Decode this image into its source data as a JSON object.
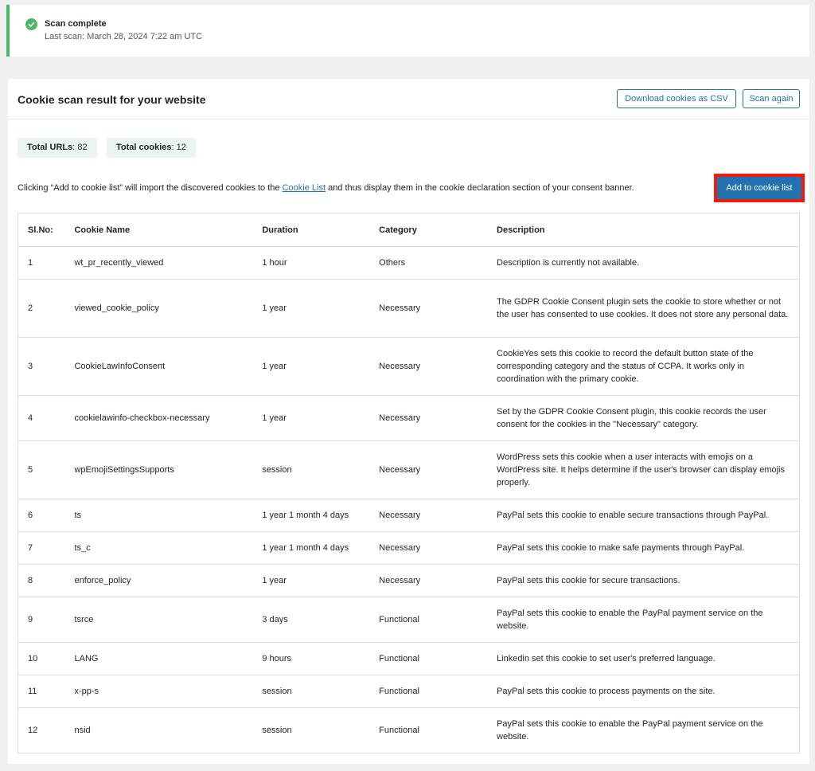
{
  "notice": {
    "title": "Scan complete",
    "last_scan": "Last scan: March 28, 2024 7:22 am UTC",
    "status_color": "#4ab866"
  },
  "panel": {
    "title": "Cookie scan result for your website",
    "download_label": "Download cookies as CSV",
    "scan_again_label": "Scan again"
  },
  "stats": {
    "urls_label": "Total URLs",
    "urls_value": ": 82",
    "cookies_label": "Total cookies",
    "cookies_value": ": 12"
  },
  "intro": {
    "before": "Clicking “Add to cookie list” will import the discovered cookies to the ",
    "link": "Cookie List",
    "after": " and thus display them in the cookie declaration section of your consent banner."
  },
  "add_button_label": "Add to cookie list",
  "table": {
    "headers": [
      "Sl.No:",
      "Cookie Name",
      "Duration",
      "Category",
      "Description"
    ],
    "rows": [
      {
        "no": "1",
        "name": "wt_pr_recently_viewed",
        "duration": "1 hour",
        "category": "Others",
        "description": "Description is currently not available."
      },
      {
        "no": "2",
        "name": "viewed_cookie_policy",
        "duration": "1 year",
        "category": "Necessary",
        "description": "The GDPR Cookie Consent plugin sets the cookie to store whether or not the user has consented to use cookies. It does not store any personal data."
      },
      {
        "no": "3",
        "name": "CookieLawInfoConsent",
        "duration": "1 year",
        "category": "Necessary",
        "description": "CookieYes sets this cookie to record the default button state of the corresponding category and the status of CCPA. It works only in coordination with the primary cookie."
      },
      {
        "no": "4",
        "name": "cookielawinfo-checkbox-necessary",
        "duration": "1 year",
        "category": "Necessary",
        "description": "Set by the GDPR Cookie Consent plugin, this cookie records the user consent for the cookies in the \"Necessary\" category."
      },
      {
        "no": "5",
        "name": "wpEmojiSettingsSupports",
        "duration": "session",
        "category": "Necessary",
        "description": "WordPress sets this cookie when a user interacts with emojis on a WordPress site. It helps determine if the user's browser can display emojis properly."
      },
      {
        "no": "6",
        "name": "ts",
        "duration": "1 year 1 month 4 days",
        "category": "Necessary",
        "description": "PayPal sets this cookie to enable secure transactions through PayPal."
      },
      {
        "no": "7",
        "name": "ts_c",
        "duration": "1 year 1 month 4 days",
        "category": "Necessary",
        "description": "PayPal sets this cookie to make safe payments through PayPal."
      },
      {
        "no": "8",
        "name": "enforce_policy",
        "duration": "1 year",
        "category": "Necessary",
        "description": "PayPal sets this cookie for secure transactions."
      },
      {
        "no": "9",
        "name": "tsrce",
        "duration": "3 days",
        "category": "Functional",
        "description": "PayPal sets this cookie to enable the PayPal payment service on the website."
      },
      {
        "no": "10",
        "name": "LANG",
        "duration": "9 hours",
        "category": "Functional",
        "description": "Linkedin set this cookie to set user's preferred language."
      },
      {
        "no": "11",
        "name": "x-pp-s",
        "duration": "session",
        "category": "Functional",
        "description": "PayPal sets this cookie to process payments on the site."
      },
      {
        "no": "12",
        "name": "nsid",
        "duration": "session",
        "category": "Functional",
        "description": "PayPal sets this cookie to enable the PayPal payment service on the website."
      }
    ]
  }
}
